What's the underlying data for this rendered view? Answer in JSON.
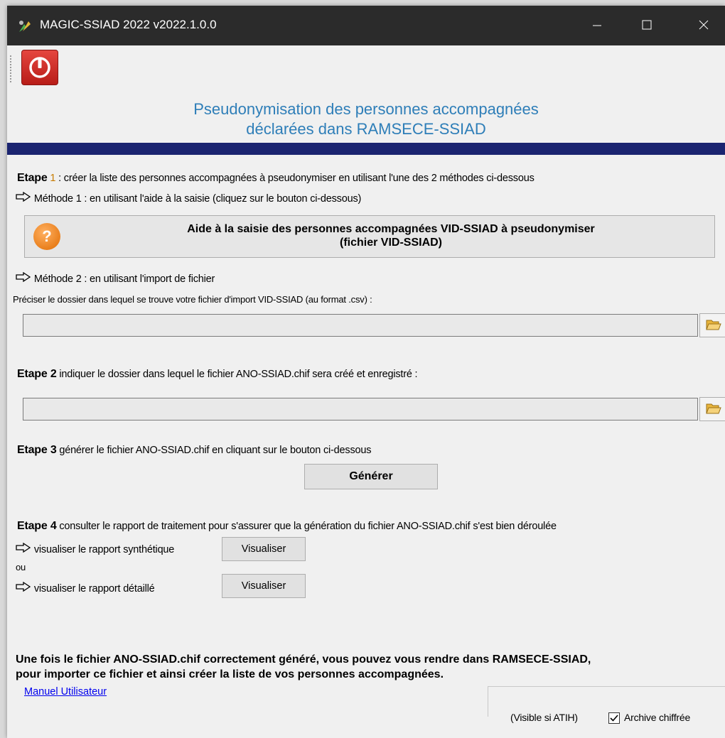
{
  "window": {
    "title": "MAGIC-SSIAD 2022 v2022.1.0.0",
    "minimize_icon": "minimize-icon",
    "maximize_icon": "maximize-icon",
    "close_icon": "close-icon"
  },
  "toolbar": {
    "power_icon": "power-icon"
  },
  "header": {
    "line1": "Pseudonymisation des personnes accompagnées",
    "line2": "déclarées dans RAMSECE-SSIAD"
  },
  "colors": {
    "heading": "#2e7eb8",
    "band": "#1b2470",
    "titlebar": "#2b2b2b"
  },
  "step1": {
    "label": "Etape",
    "number": "1",
    "text": " : créer la liste des personnes accompagnées à pseudonymiser en utilisant l'une des 2 méthodes ci-dessous",
    "method1": "Méthode 1 : en utilisant l'aide à la saisie (cliquez sur le bouton ci-dessous)",
    "help_button_line1": "Aide à la saisie des personnes accompagnées VID-SSIAD à pseudonymiser",
    "help_button_line2": "(fichier VID-SSIAD)",
    "method2": "Méthode 2 : en utilisant l'import de fichier",
    "folder_prompt": "Préciser le dossier dans lequel se trouve votre fichier d'import VID-SSIAD (au format .csv) :",
    "import_path_value": ""
  },
  "step2": {
    "label": "Etape 2",
    "text": " indiquer le dossier dans lequel le fichier ANO-SSIAD.chif sera créé et enregistré :",
    "output_path_value": ""
  },
  "step3": {
    "label": "Etape 3",
    "text": " générer le fichier ANO-SSIAD.chif en cliquant sur le bouton ci-dessous",
    "generate_button": "Générer"
  },
  "step4": {
    "label": "Etape 4",
    "text": " consulter le rapport de traitement pour s'assurer que la génération du fichier ANO-SSIAD.chif s'est bien déroulée",
    "summary_report": "visualiser le rapport synthétique",
    "summary_button": "Visualiser",
    "or": "ou",
    "detailed_report": "visualiser le rapport détaillé",
    "detailed_button": "Visualiser"
  },
  "final_note": {
    "line1": "Une fois le fichier ANO-SSIAD.chif correctement généré, vous pouvez vous rendre dans RAMSECE-SSIAD,",
    "line2": "pour importer ce fichier et ainsi créer la liste de vos personnes accompagnées."
  },
  "footer": {
    "manual_link": "Manuel Utilisateur",
    "visible_note": "(Visible si ATIH)",
    "archive_label": "Archive chiffrée",
    "archive_checked": true
  }
}
